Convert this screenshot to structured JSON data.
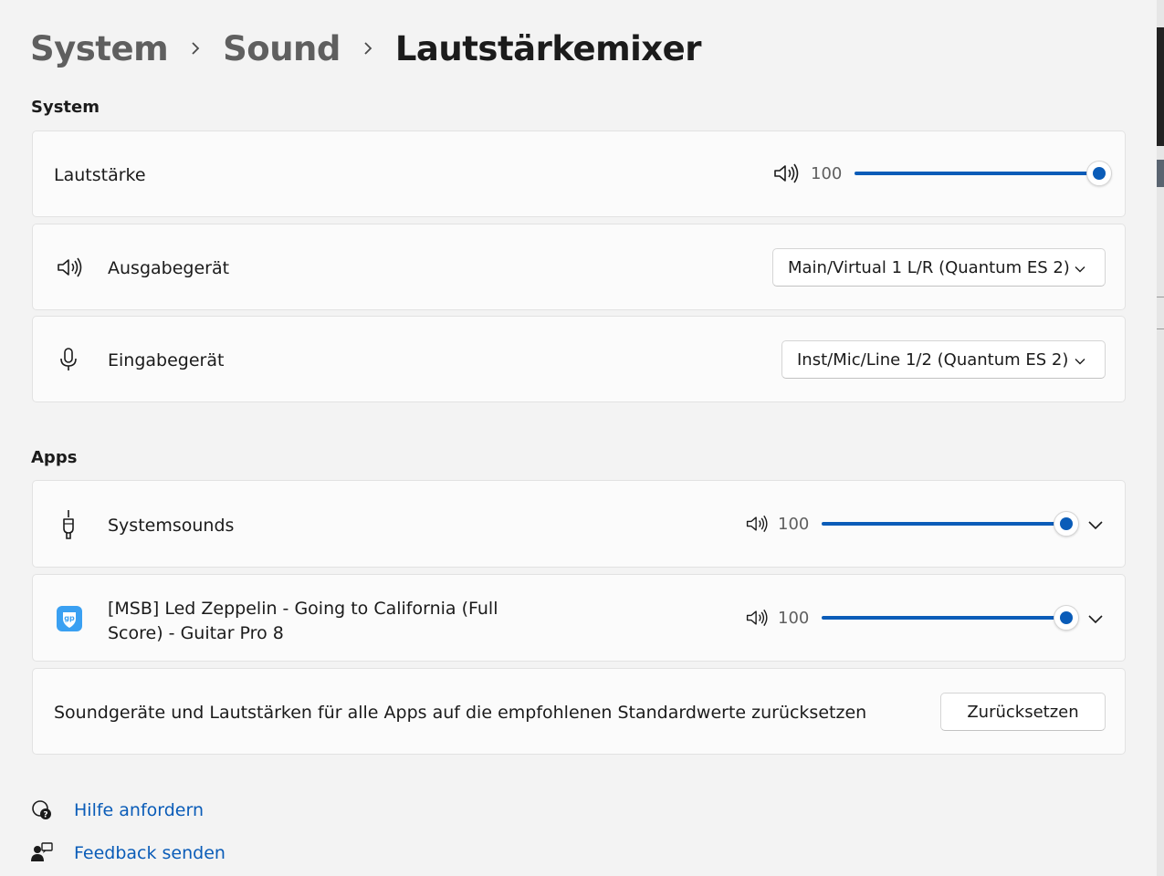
{
  "breadcrumb": {
    "root": "System",
    "parent": "Sound",
    "current": "Lautstärkemixer"
  },
  "system_section": {
    "heading": "System",
    "volume": {
      "label": "Lautstärke",
      "value": "100",
      "level": 1.0,
      "icon": "speaker-icon"
    },
    "output": {
      "label": "Ausgabegerät",
      "selected": "Main/Virtual 1 L/R (Quantum ES 2)",
      "icon": "speaker-icon"
    },
    "input": {
      "label": "Eingabegerät",
      "selected": "Inst/Mic/Line 1/2 (Quantum ES 2)",
      "icon": "microphone-icon"
    }
  },
  "apps_section": {
    "heading": "Apps",
    "apps": [
      {
        "name": "Systemsounds",
        "value": "100",
        "level": 1.0,
        "icon": "system-sounds-icon"
      },
      {
        "name_line1": "[MSB] Led Zeppelin - Going to California (Full",
        "name_line2": "Score) - Guitar Pro 8",
        "value": "100",
        "level": 1.0,
        "icon": "guitar-pro-icon"
      }
    ],
    "reset": {
      "text": "Soundgeräte und Lautstärken für alle Apps auf die empfohlenen Standardwerte zurücksetzen",
      "button": "Zurücksetzen"
    }
  },
  "links": {
    "help": "Hilfe anfordern",
    "feedback": "Feedback senden"
  },
  "colors": {
    "accent": "#0a5cb8",
    "background": "#f3f3f3",
    "card": "#fbfbfb"
  }
}
